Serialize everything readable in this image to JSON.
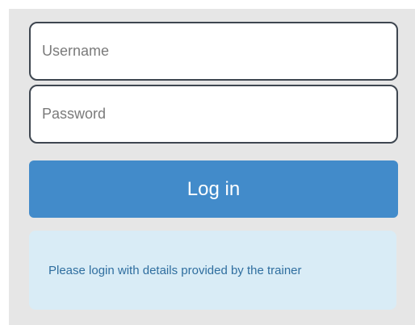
{
  "login_form": {
    "username_placeholder": "Username",
    "password_placeholder": "Password",
    "login_button_label": "Log in",
    "info_message": "Please login with details provided by the trainer"
  },
  "colors": {
    "panel_background": "#e6e6e6",
    "button_background": "#428bca",
    "info_background": "#d9ecf6",
    "info_text": "#2f6e9f",
    "field_border": "#3e4650"
  }
}
